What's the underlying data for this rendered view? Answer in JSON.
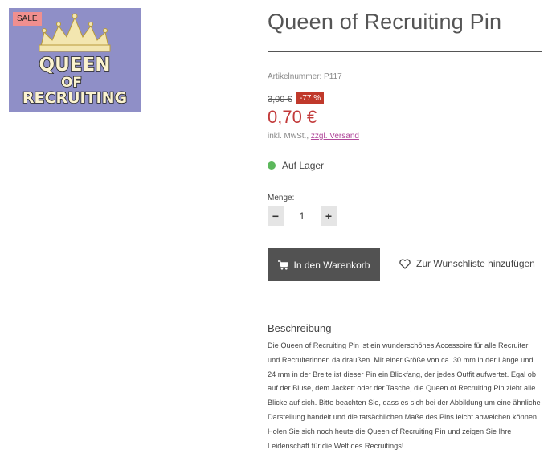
{
  "product": {
    "sale_badge": "SALE",
    "image_text_line1": "QUEEN",
    "image_text_line2": "OF",
    "image_text_line3": "RECRUITING",
    "title": "Queen of Recruiting Pin",
    "sku_label": "Artikelnummer:",
    "sku_value": "P117",
    "old_price": "3,00 €",
    "discount": "-77 %",
    "price": "0,70 €",
    "tax_text": "inkl. MwSt.,",
    "shipping_link": "zzgl. Versand",
    "stock_text": "Auf Lager",
    "quantity_label": "Menge:",
    "quantity_value": "1",
    "minus_label": "−",
    "plus_label": "+",
    "cart_button_label": "In den Warenkorb",
    "wishlist_label": "Zur Wunschliste hinzufügen",
    "description_heading": "Beschreibung",
    "description_text": "Die Queen of Recruiting Pin ist ein wunderschönes Accessoire für alle Recruiter und Recruiterinnen da draußen. Mit einer Größe von ca. 30 mm in der Länge und 24 mm in der Breite ist dieser Pin ein Blickfang, der jedes Outfit aufwertet. Egal ob auf der Bluse, dem Jackett oder der Tasche, die Queen of Recruiting Pin zieht alle Blicke auf sich. Bitte beachten Sie, dass es sich bei der Abbildung um eine ähnliche Darstellung handelt und die tatsächlichen Maße des Pins leicht abweichen können. Holen Sie sich noch heute die Queen of Recruiting Pin und zeigen Sie Ihre Leidenschaft für die Welt des Recruitings!"
  },
  "colors": {
    "price": "#c23a3a",
    "discount_bg": "#c0392b",
    "stock_dot": "#5cb85c",
    "cart_button_bg": "#525252",
    "shipping_link": "#b0479a",
    "image_bg": "#8f8fc7"
  },
  "icons": {
    "cart": "shopping-cart-icon",
    "wishlist": "heart-icon",
    "stock": "status-dot-icon"
  }
}
